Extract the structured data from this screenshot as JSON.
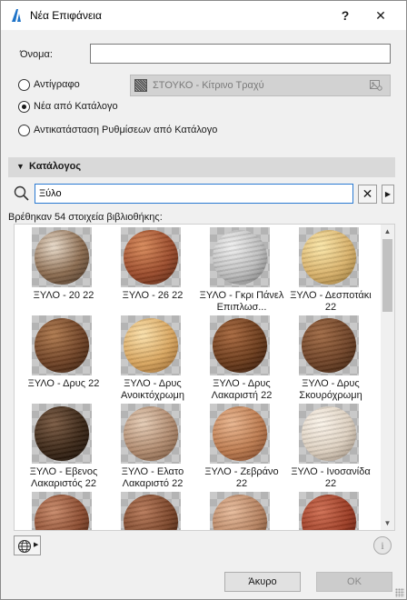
{
  "window": {
    "title": "Νέα Επιφάνεια",
    "help_label": "?",
    "close_label": "✕"
  },
  "name_field": {
    "label": "Όνομα:",
    "value": ""
  },
  "options": [
    {
      "label": "Αντίγραφο",
      "selected": false
    },
    {
      "label": "Νέα από Κατάλογο",
      "selected": true
    },
    {
      "label": "Αντικατάσταση Ρυθμίσεων από Κατάλογο",
      "selected": false
    }
  ],
  "copy_source": {
    "value": "ΣΤΟΥΚΟ - Κίτρινο Τραχύ",
    "icon": "image-settings-icon"
  },
  "catalog": {
    "title": "Κατάλογος",
    "arrow": "▼",
    "search_value": "Ξύλο",
    "clear_label": "✕",
    "more_label": "▶",
    "results_text": "Βρέθηκαν 54 στοιχεία βιβλιοθήκης:",
    "items": [
      {
        "label": "ΞΥΛΟ - 20 22",
        "color1": "#eadccb",
        "color2": "#8a6a4e",
        "color3": "#3a2a1e"
      },
      {
        "label": "ΞΥΛΟ - 26 22",
        "color1": "#d98a5a",
        "color2": "#9a4a2a",
        "color3": "#4a1e0e"
      },
      {
        "label": "ΞΥΛΟ - Γκρι Πάνελ Επιπλωσ...",
        "color1": "#f0f0f0",
        "color2": "#bdbdbd",
        "color3": "#6a6a6a"
      },
      {
        "label": "ΞΥΛΟ - Δεσποτάκι 22",
        "color1": "#fbe7a9",
        "color2": "#d8b16a",
        "color3": "#8a6a2e"
      },
      {
        "label": "ΞΥΛΟ - Δρυς 22",
        "color1": "#b07a4e",
        "color2": "#6e4124",
        "color3": "#2e180a"
      },
      {
        "label": "ΞΥΛΟ - Δρυς Ανοικτόχρωμη",
        "color1": "#fbe1ab",
        "color2": "#d8a55e",
        "color3": "#8a5a26"
      },
      {
        "label": "ΞΥΛΟ - Δρυς Λακαριστή 22",
        "color1": "#a8683e",
        "color2": "#6a3a1a",
        "color3": "#2a1206"
      },
      {
        "label": "ΞΥΛΟ - Δρυς Σκουρόχρωμη",
        "color1": "#a06a44",
        "color2": "#6e4226",
        "color3": "#321a0a"
      },
      {
        "label": "ΞΥΛΟ - Εβενος Λακαριστός 22",
        "color1": "#7a5a42",
        "color2": "#3a2616",
        "color3": "#120a04"
      },
      {
        "label": "ΞΥΛΟ - Ελατο Λακαριστό 22",
        "color1": "#e6cdb6",
        "color2": "#b08a6e",
        "color3": "#6a4a32"
      },
      {
        "label": "ΞΥΛΟ - Ζεβράνο 22",
        "color1": "#e9b58e",
        "color2": "#bc7a4e",
        "color3": "#6e3a1e"
      },
      {
        "label": "ΞΥΛΟ - Ινοσανίδα 22",
        "color1": "#fbf4ea",
        "color2": "#ddd0c0",
        "color3": "#8a7a6a"
      },
      {
        "label": "",
        "color1": "#c98a6a",
        "color2": "#8a4a2e",
        "color3": "#3a1a0e"
      },
      {
        "label": "",
        "color1": "#b87a5a",
        "color2": "#7a4428",
        "color3": "#2e1608"
      },
      {
        "label": "",
        "color1": "#e8bc9c",
        "color2": "#b4805e",
        "color3": "#5e3a20"
      },
      {
        "label": "",
        "color1": "#d06e52",
        "color2": "#9a3a22",
        "color3": "#4a140a"
      }
    ]
  }
}
